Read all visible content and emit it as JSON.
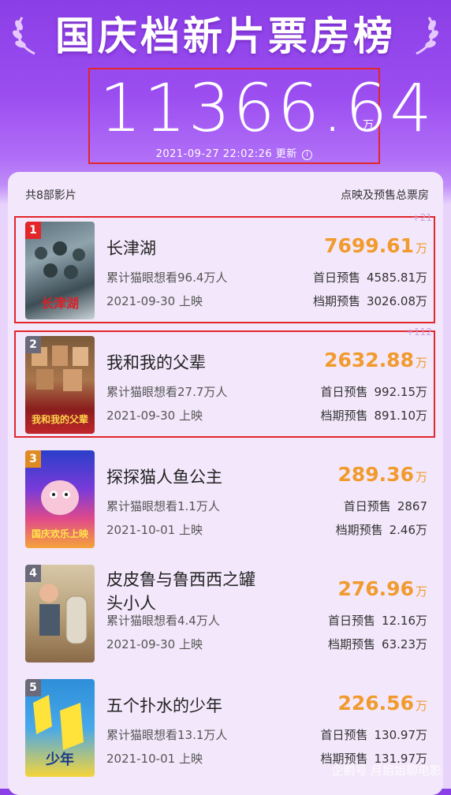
{
  "header": {
    "title": "国庆档新片票房榜",
    "total_value": "11366.64",
    "total_unit": "万",
    "update_time": "2021-09-27 22:02:26",
    "update_label": "更新",
    "info_icon": "ⓘ"
  },
  "list": {
    "count_label": "共8部影片",
    "right_label": "点映及预售总票房",
    "presale_first_label": "首日预售",
    "presale_period_label": "档期预售",
    "unit": "万"
  },
  "movies": [
    {
      "rank": "1",
      "name": "长津湖",
      "want": "累计猫眼想看96.4万人",
      "release": "2021-09-30 上映",
      "box": "7699.61",
      "delta": "+21",
      "first_day": "4585.81万",
      "period": "3026.08万",
      "poster_text": "长津湖"
    },
    {
      "rank": "2",
      "name": "我和我的父辈",
      "want": "累计猫眼想看27.7万人",
      "release": "2021-09-30 上映",
      "box": "2632.88",
      "delta": "+112",
      "first_day": "992.15万",
      "period": "891.10万",
      "poster_text": "我和我的父辈"
    },
    {
      "rank": "3",
      "name": "探探猫人鱼公主",
      "want": "累计猫眼想看1.1万人",
      "release": "2021-10-01 上映",
      "box": "289.36",
      "delta": "",
      "first_day": "2867",
      "period": "2.46万",
      "poster_text": "国庆欢乐上映"
    },
    {
      "rank": "4",
      "name": "皮皮鲁与鲁西西之罐头小人",
      "want": "累计猫眼想看4.4万人",
      "release": "2021-09-30 上映",
      "box": "276.96",
      "delta": "",
      "first_day": "12.16万",
      "period": "63.23万",
      "poster_text": ""
    },
    {
      "rank": "5",
      "name": "五个扑水的少年",
      "want": "累计猫眼想看13.1万人",
      "release": "2021-10-01 上映",
      "box": "226.56",
      "delta": "",
      "first_day": "130.97万",
      "period": "131.97万",
      "poster_text": "少年"
    }
  ],
  "watermark": "企鹅号 月姐姐聊电影",
  "colors": {
    "accent": "#f19a2d",
    "highlight_border": "#e2262a",
    "header_purple": "#8a3fe6"
  }
}
